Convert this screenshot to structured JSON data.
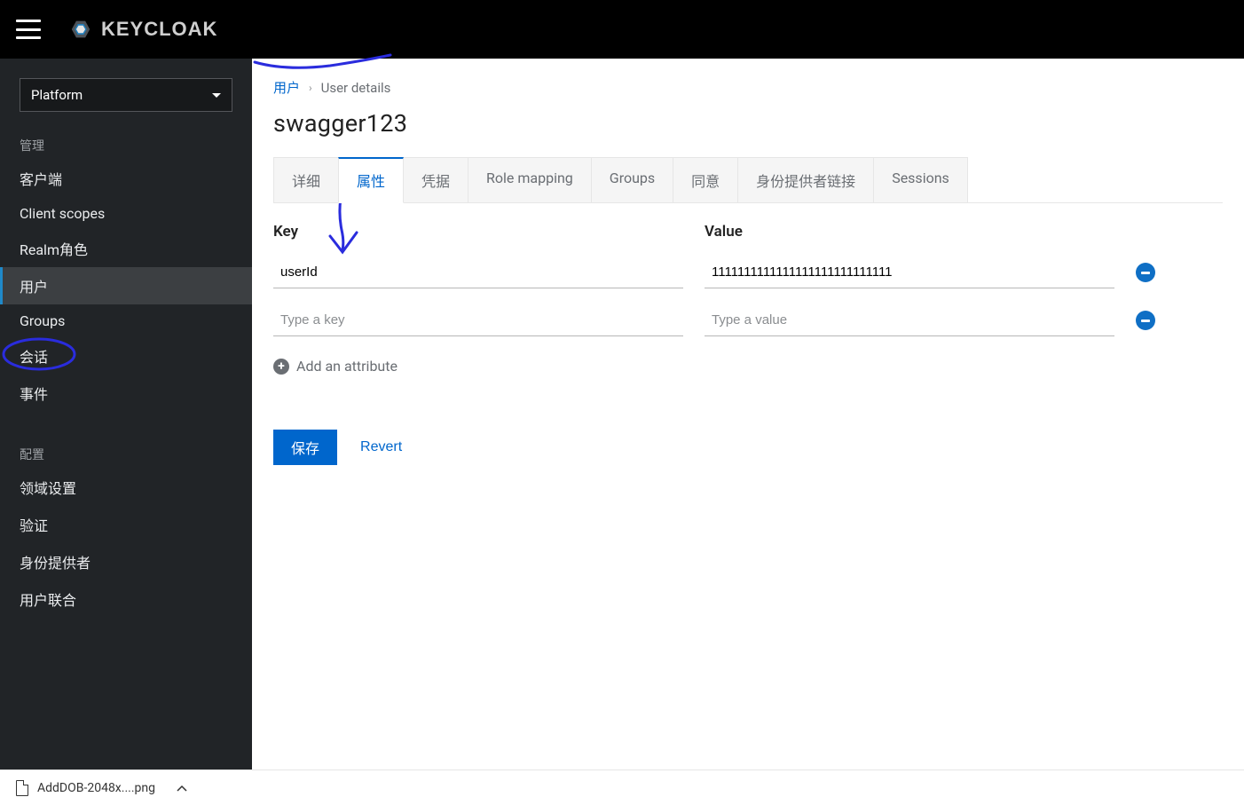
{
  "topbar": {
    "brand_text": "KEYCLOAK"
  },
  "sidebar": {
    "realm": "Platform",
    "section_manage": "管理",
    "section_config": "配置",
    "items_manage": [
      {
        "label": "客户端"
      },
      {
        "label": "Client scopes"
      },
      {
        "label": "Realm角色"
      },
      {
        "label": "用户",
        "active": true
      },
      {
        "label": "Groups"
      },
      {
        "label": "会话"
      },
      {
        "label": "事件"
      }
    ],
    "items_config": [
      {
        "label": "领域设置"
      },
      {
        "label": "验证"
      },
      {
        "label": "身份提供者"
      },
      {
        "label": "用户联合"
      }
    ]
  },
  "breadcrumb": {
    "link": "用户",
    "current": "User details"
  },
  "page_title": "swagger123",
  "tabs": [
    {
      "label": "详细"
    },
    {
      "label": "属性",
      "active": true
    },
    {
      "label": "凭据"
    },
    {
      "label": "Role mapping"
    },
    {
      "label": "Groups"
    },
    {
      "label": "同意"
    },
    {
      "label": "身份提供者链接"
    },
    {
      "label": "Sessions"
    }
  ],
  "attr": {
    "key_header": "Key",
    "value_header": "Value",
    "rows": [
      {
        "key": "userId",
        "value": "1111111111111111111111111111"
      },
      {
        "key": "",
        "value": ""
      }
    ],
    "key_placeholder": "Type a key",
    "value_placeholder": "Type a value",
    "add_label": "Add an attribute"
  },
  "buttons": {
    "save": "保存",
    "revert": "Revert"
  },
  "shelf": {
    "filename": "AddDOB-2048x....png"
  }
}
